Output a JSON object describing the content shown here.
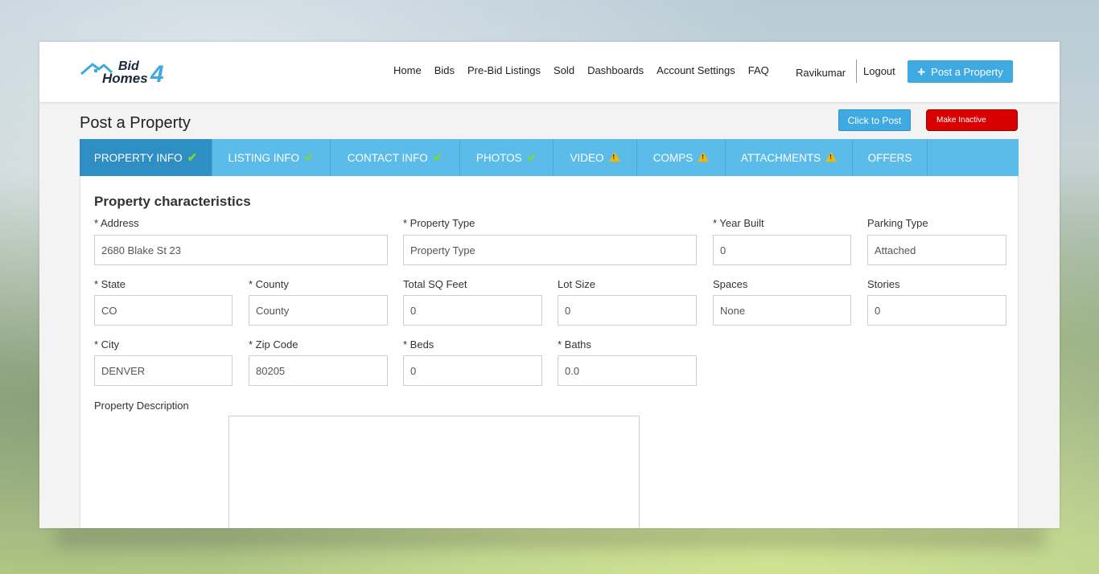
{
  "brand": {
    "logo_text_top": "Bid",
    "logo_text_bottom": "Homes",
    "logo_digit": "4"
  },
  "nav": {
    "items": [
      "Home",
      "Bids",
      "Pre-Bid Listings",
      "Sold",
      "Dashboards",
      "Account Settings",
      "FAQ"
    ],
    "user": "Ravikumar",
    "logout": "Logout",
    "post_property": "Post a Property"
  },
  "page": {
    "title": "Post a Property",
    "click_to_post": "Click to Post",
    "make_inactive": "Make Inactive"
  },
  "tabs": [
    {
      "label": "PROPERTY INFO",
      "status": "check",
      "active": true
    },
    {
      "label": "LISTING INFO",
      "status": "check"
    },
    {
      "label": "CONTACT INFO",
      "status": "check"
    },
    {
      "label": "PHOTOS",
      "status": "check"
    },
    {
      "label": "VIDEO",
      "status": "warning"
    },
    {
      "label": "COMPS",
      "status": "warning"
    },
    {
      "label": "ATTACHMENTS",
      "status": "warning"
    },
    {
      "label": "OFFERS",
      "status": "none"
    }
  ],
  "form": {
    "section_title": "Property characteristics",
    "address": {
      "label": "* Address",
      "value": "2680 Blake St 23"
    },
    "property_type": {
      "label": "* Property Type",
      "placeholder": "Property Type"
    },
    "year_built": {
      "label": "* Year Built",
      "value": "0"
    },
    "parking_type": {
      "label": "Parking Type",
      "value": "Attached"
    },
    "state": {
      "label": "* State",
      "value": "CO"
    },
    "county": {
      "label": "* County",
      "placeholder": "County"
    },
    "total_sq_feet": {
      "label": "Total SQ Feet",
      "value": "0"
    },
    "lot_size": {
      "label": "Lot Size",
      "value": "0"
    },
    "spaces": {
      "label": "Spaces",
      "value": "None"
    },
    "stories": {
      "label": "Stories",
      "value": "0"
    },
    "city": {
      "label": "* City",
      "value": "DENVER"
    },
    "zip_code": {
      "label": "* Zip Code",
      "value": "80205"
    },
    "beds": {
      "label": "* Beds",
      "value": "0"
    },
    "baths": {
      "label": "* Baths",
      "value": "0.0"
    },
    "description": {
      "label": "Property Description",
      "value": ""
    }
  },
  "colors": {
    "accent": "#3fa9e2",
    "tab_bar": "#5bbce9",
    "tab_active": "#2d8fc3",
    "danger": "#d80000",
    "check": "#7cd63c",
    "warning": "#f5b700"
  }
}
